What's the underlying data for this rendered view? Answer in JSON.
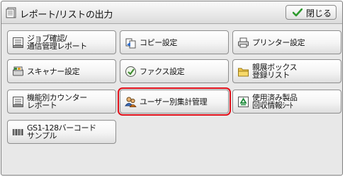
{
  "title": "レポート/リストの出力",
  "close_label": "閉じる",
  "buttons": [
    {
      "label": "ジョブ確認/\n通信管理レポート"
    },
    {
      "label": "コピー設定"
    },
    {
      "label": "プリンター設定"
    },
    {
      "label": "スキャナー設定"
    },
    {
      "label": "ファクス設定"
    },
    {
      "label": "親展ボックス\n登録リスト"
    },
    {
      "label": "機能別カウンター\nレポート"
    },
    {
      "label": "ユーザー別集計管理",
      "selected": true
    },
    {
      "label": "使用済み製品\n回収情報ｼｰﾄ"
    },
    {
      "label": "GS1-128バーコード\nサンプル"
    }
  ]
}
